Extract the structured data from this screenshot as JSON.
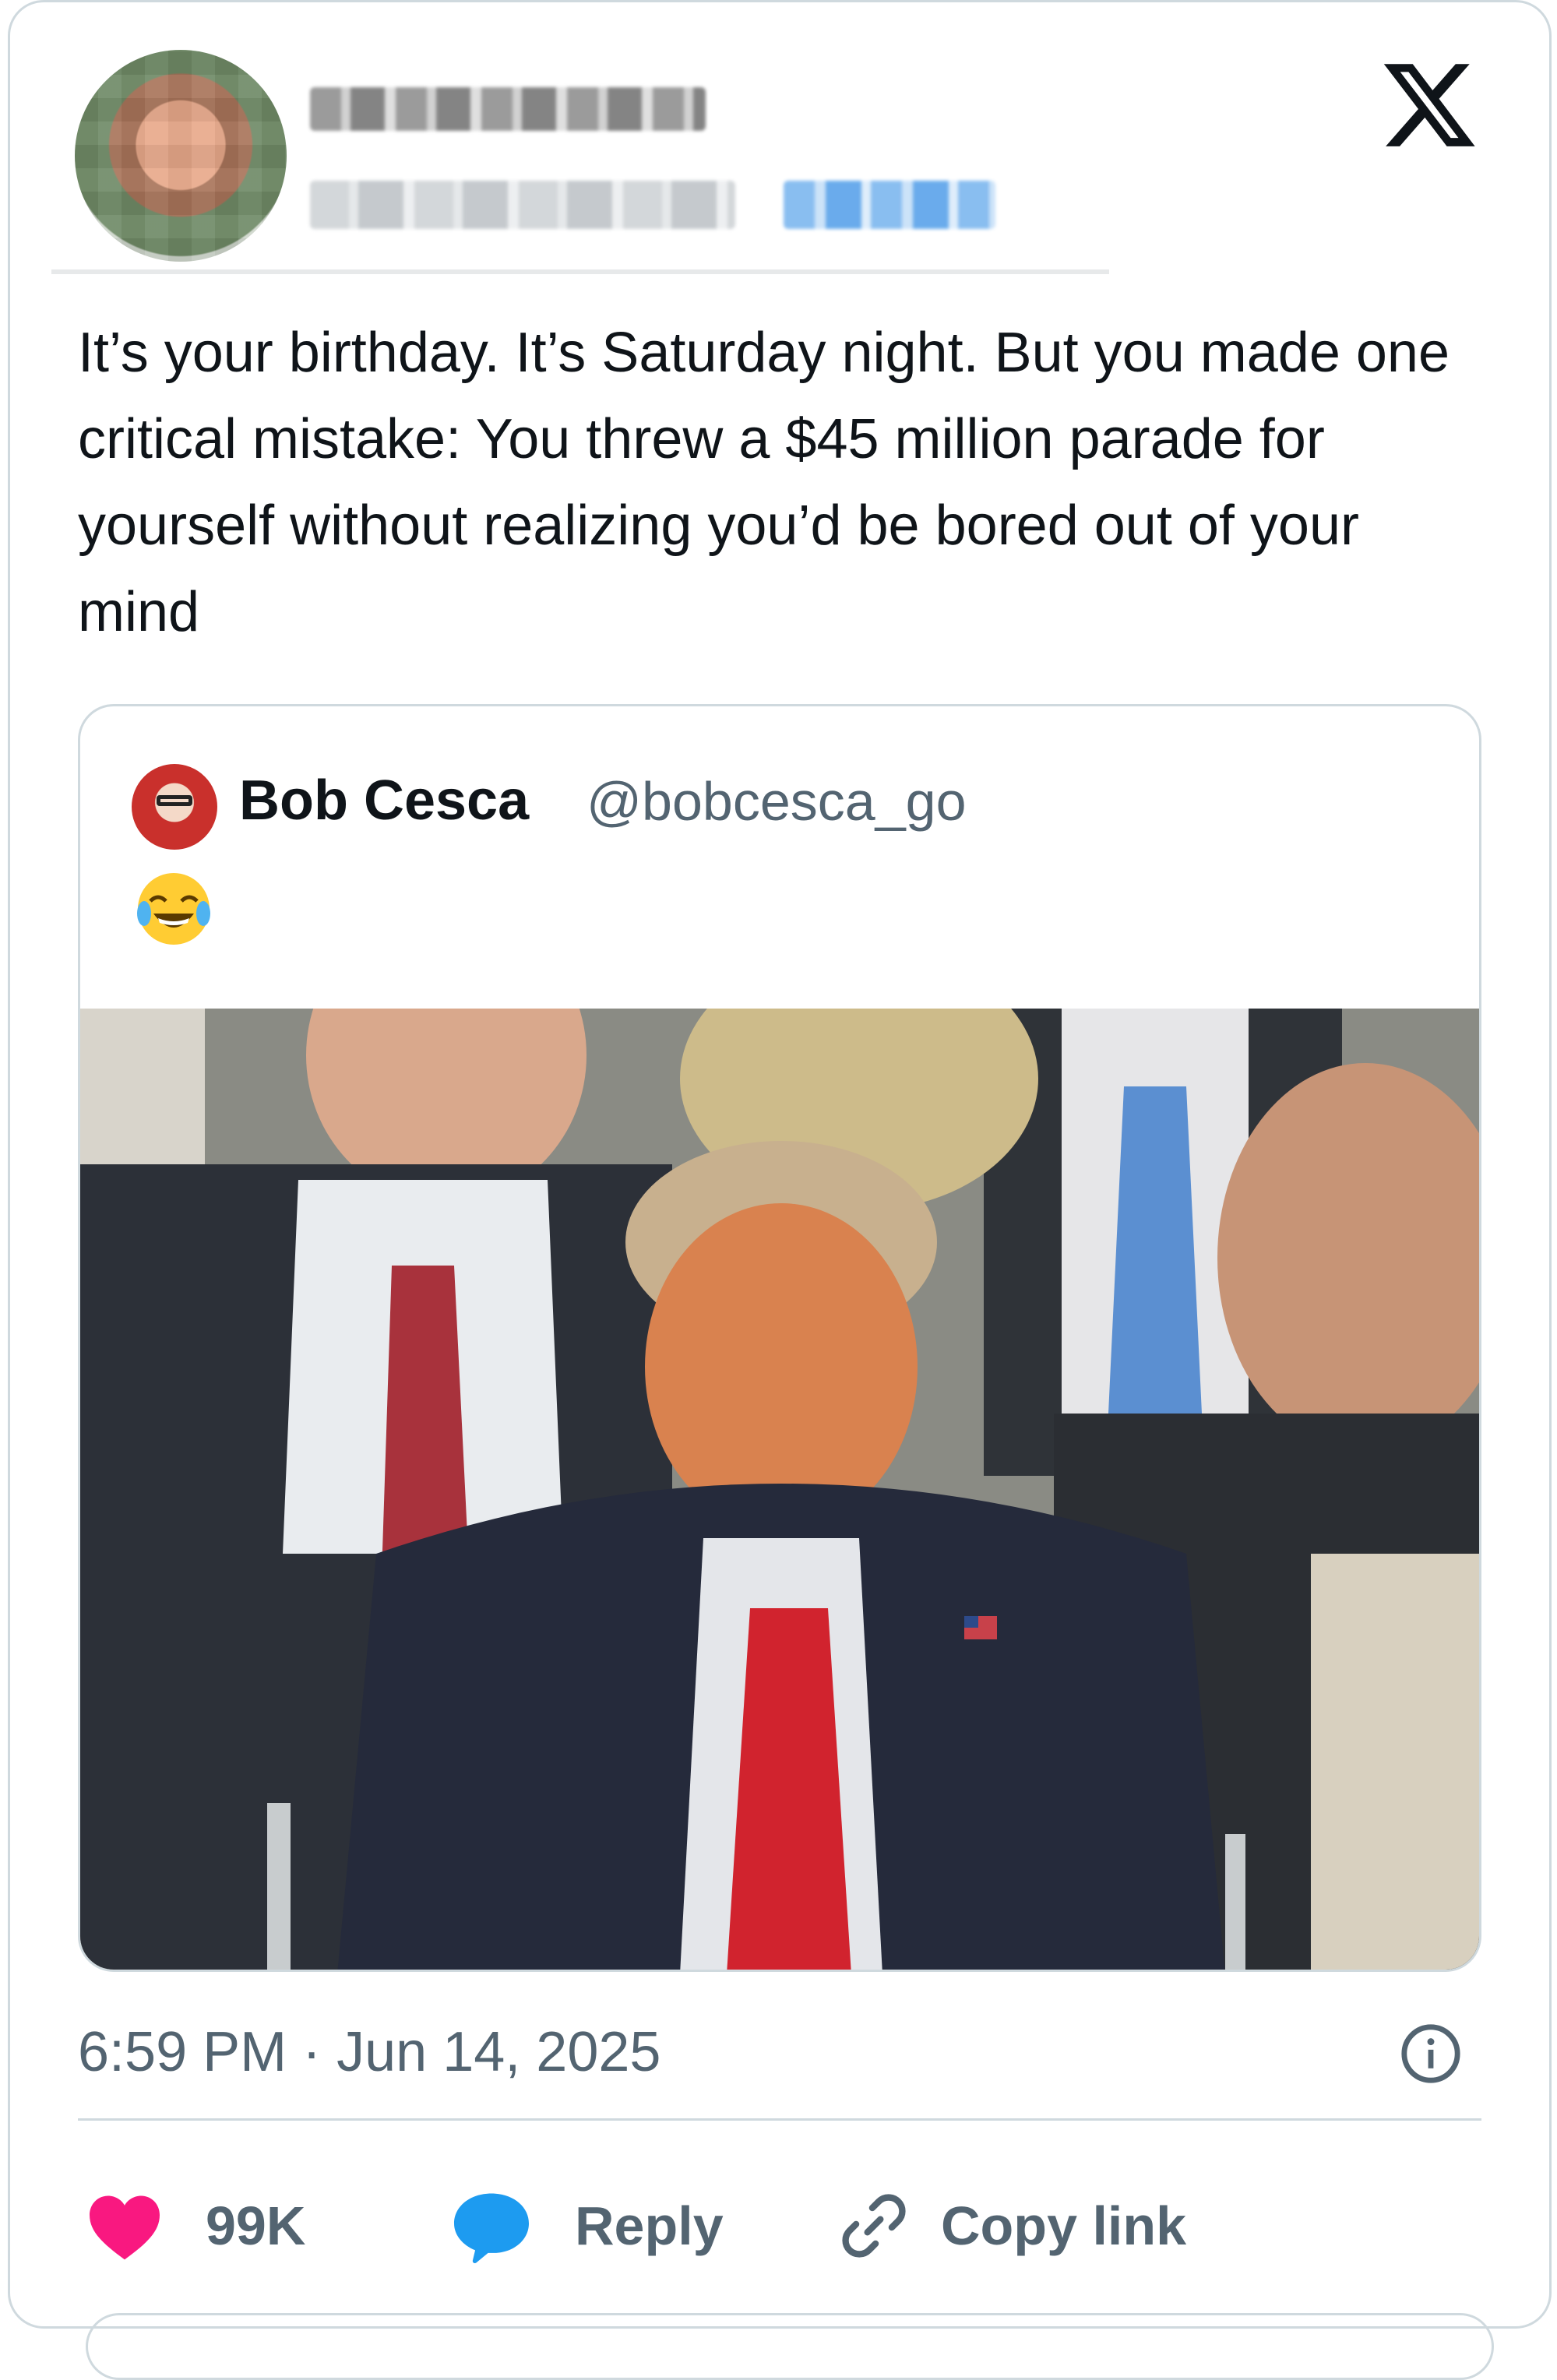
{
  "tweet": {
    "text": "It’s your birthday. It’s Saturday night. But you made one critical mistake: You threw a $45 million parade for yourself without realizing you’d be bored out of your mind",
    "timestamp": "6:59 PM · Jun 14, 2025"
  },
  "quoted_tweet": {
    "author_name": "Bob Cesca",
    "author_handle": "@bobcesca_go",
    "text_emoji": "face-with-tears-of-joy"
  },
  "actions": {
    "like_count": "99K",
    "reply_label": "Reply",
    "copy_label": "Copy link"
  },
  "colors": {
    "like": "#f91880",
    "reply": "#1d9bf0",
    "muted": "#536471",
    "border": "#cfd9de"
  },
  "icons": [
    "x-logo-icon",
    "heart-icon",
    "speech-bubble-icon",
    "link-icon",
    "info-icon"
  ]
}
